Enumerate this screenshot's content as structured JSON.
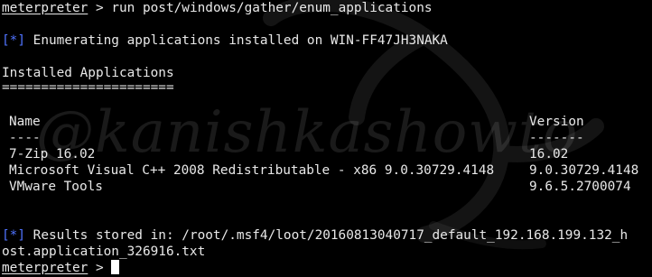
{
  "terminal": {
    "prompt": "meterpreter",
    "prompt_suffix": " > ",
    "command": "run post/windows/gather/enum_applications",
    "info_tag": "[*]",
    "enum_message": " Enumerating applications installed on WIN-FF47JH3NAKA",
    "section_title": "Installed Applications",
    "section_underline": "======================",
    "table": {
      "headers": {
        "name": "Name",
        "version": "Version"
      },
      "separators": {
        "name": "----",
        "version": "-------"
      },
      "rows": [
        {
          "name": "7-Zip 16.02",
          "version": "16.02"
        },
        {
          "name": "Microsoft Visual C++ 2008 Redistributable - x86 9.0.30729.4148",
          "version": "9.0.30729.4148"
        },
        {
          "name": "VMware Tools",
          "version": "9.6.5.2700074"
        }
      ]
    },
    "results_line1": " Results stored in: /root/.msf4/loot/20160813040717_default_192.168.199.132_h",
    "results_line2": "ost.application_326916.txt"
  },
  "watermark": "@kanishkashowto",
  "colors": {
    "background": "#000000",
    "text": "#e8e8e8",
    "info_tag": "#4f73ff"
  }
}
